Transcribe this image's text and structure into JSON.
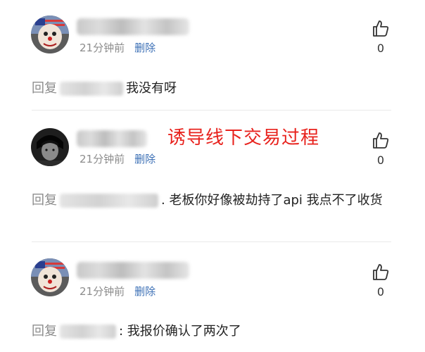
{
  "comments": [
    {
      "time": "21分钟前",
      "delete_label": "删除",
      "like_count": "0",
      "reply_prefix": "回复",
      "reply_text": "我没有呀"
    },
    {
      "time": "21分钟前",
      "delete_label": "删除",
      "like_count": "0",
      "reply_prefix": "回复",
      "reply_text": ". 老板你好像被劫持了api 我点不了收货"
    },
    {
      "time": "21分钟前",
      "delete_label": "删除",
      "like_count": "0",
      "reply_prefix": "回复",
      "reply_text": ": 我报价确认了两次了"
    }
  ],
  "annotation": "诱导线下交易过程",
  "colors": {
    "annotation": "#e8221d",
    "link": "#3b6fb5",
    "muted": "#8c8c8c"
  },
  "icons": {
    "like": "thumbs-up-icon"
  }
}
